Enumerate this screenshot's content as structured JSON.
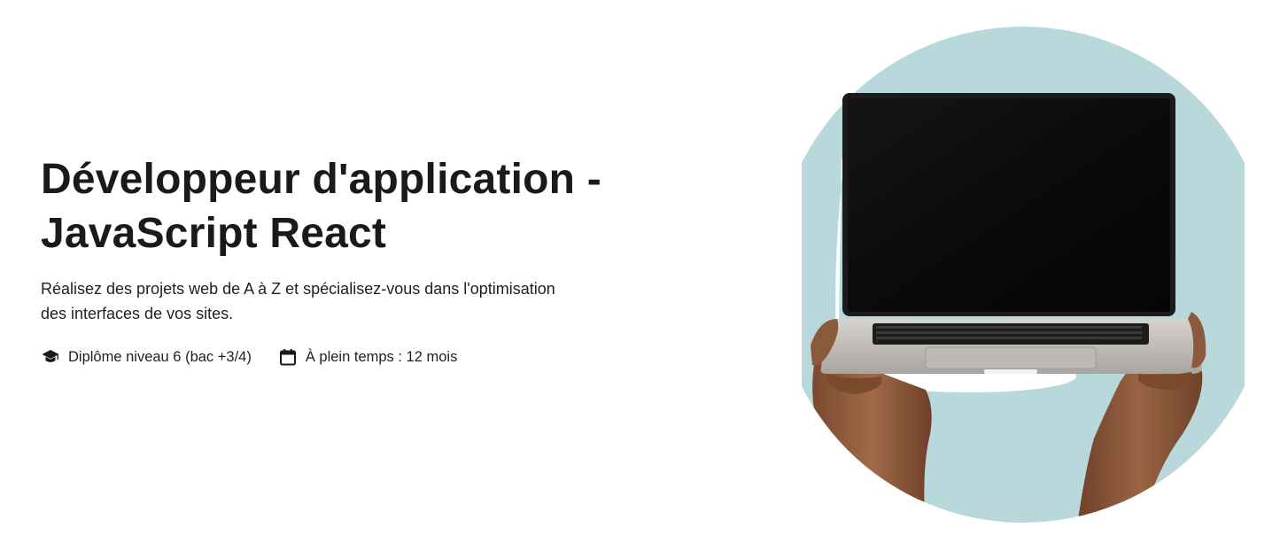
{
  "hero": {
    "title_line1": "Développeur d'application -",
    "title_line2": "JavaScript React",
    "subtitle_line1": "Réalisez des projets web de A à Z et spécialisez-vous dans l'optimisation",
    "subtitle_line2": "des interfaces de vos sites.",
    "meta": [
      {
        "icon": "graduation-cap-icon",
        "label": "Diplôme niveau 6 (bac +3/4)"
      },
      {
        "icon": "calendar-icon",
        "label": "À plein temps : 12 mois"
      }
    ]
  },
  "colors": {
    "circle": "#b8d8dc",
    "text": "#1a1a1a",
    "screen": "#0a0a0a",
    "laptop_body": "#c4c1bd",
    "skin": "#8a5a3c"
  }
}
